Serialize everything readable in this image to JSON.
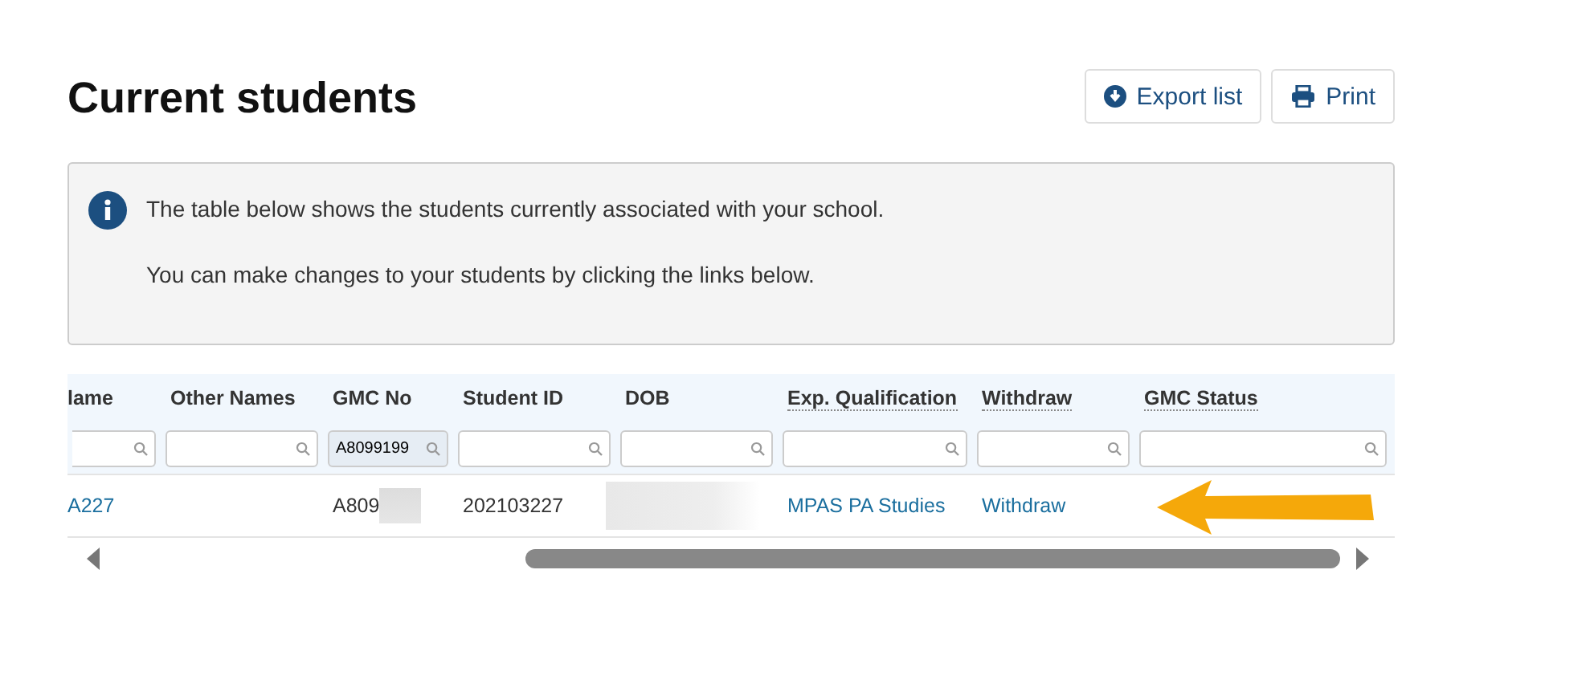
{
  "title": "Current students",
  "actions": [
    {
      "label": "Export list",
      "kind": "export"
    },
    {
      "label": "Print",
      "kind": "print"
    }
  ],
  "info": {
    "lines": [
      "The table below shows the students currently associated with your school.",
      "You can make changes to your students by clicking the links below."
    ]
  },
  "table": {
    "columns": [
      {
        "label": "lame",
        "underlined": false
      },
      {
        "label": "Other Names",
        "underlined": false
      },
      {
        "label": "GMC No",
        "underlined": false,
        "filter": "A8099199"
      },
      {
        "label": "Student ID",
        "underlined": false
      },
      {
        "label": "DOB",
        "underlined": false
      },
      {
        "label": "Exp. Qualification",
        "underlined": true
      },
      {
        "label": "Withdraw",
        "underlined": true
      },
      {
        "label": "GMC Status",
        "underlined": true
      }
    ],
    "rows": [
      [
        {
          "kind": "link",
          "text": "A227"
        },
        {
          "kind": "empty"
        },
        {
          "kind": "redacted",
          "text": "A809"
        },
        {
          "kind": "text",
          "text": "202103227"
        },
        {
          "kind": "redacted"
        },
        {
          "kind": "link",
          "text": "MPAS PA Studies"
        },
        {
          "kind": "link",
          "text": "Withdraw"
        },
        {
          "kind": "empty"
        }
      ]
    ]
  }
}
